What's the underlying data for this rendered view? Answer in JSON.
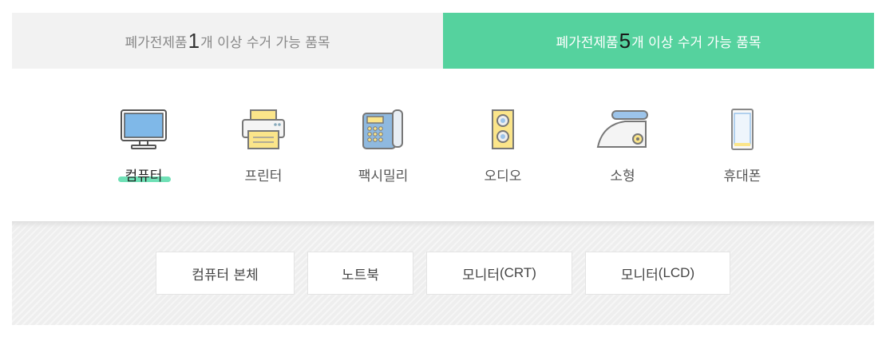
{
  "tabs": [
    {
      "prefix": "폐가전제품 ",
      "num": "1",
      "suffix": "개 이상 수거 가능 품목"
    },
    {
      "prefix": "폐가전제품 ",
      "num": "5",
      "suffix": "개 이상 수거 가능 품목"
    }
  ],
  "categories": [
    {
      "label": "컴퓨터",
      "icon": "monitor-icon"
    },
    {
      "label": "프린터",
      "icon": "printer-icon"
    },
    {
      "label": "팩시밀리",
      "icon": "fax-icon"
    },
    {
      "label": "오디오",
      "icon": "speaker-icon"
    },
    {
      "label": "소형",
      "icon": "iron-icon"
    },
    {
      "label": "휴대폰",
      "icon": "phone-icon"
    }
  ],
  "active_category": "컴퓨터",
  "sub_items": [
    {
      "label": "컴퓨터 본체"
    },
    {
      "label": "노트북"
    },
    {
      "label": "모니터",
      "paren": "(CRT)"
    },
    {
      "label": "모니터",
      "paren": "(LCD)"
    }
  ],
  "colors": {
    "accent": "#55d29e",
    "underline": "#6fe0b6",
    "icon_fill_blue": "#7fb8e8",
    "icon_fill_yellow": "#fbe58a"
  }
}
